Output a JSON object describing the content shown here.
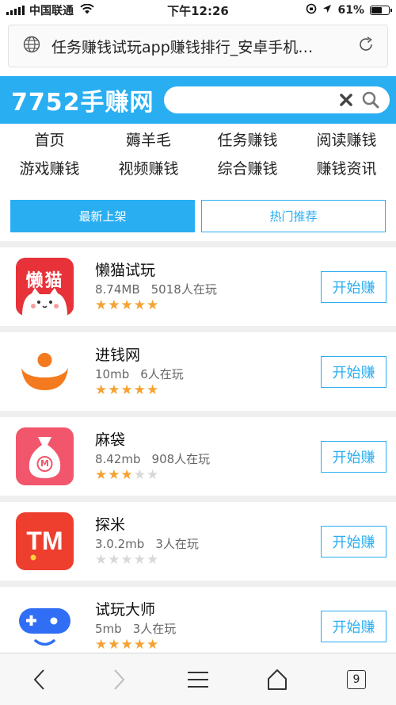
{
  "status_bar": {
    "carrier": "中国联通",
    "time": "下午12:26",
    "battery_text": "61%",
    "battery_level": 0.61
  },
  "address_bar": {
    "page_title": "任务赚钱试玩app赚钱排行_安卓手机…"
  },
  "header": {
    "logo": "7752手赚网",
    "search": {
      "value": "",
      "placeholder": ""
    }
  },
  "nav": {
    "items": [
      {
        "label": "首页"
      },
      {
        "label": "薅羊毛"
      },
      {
        "label": "任务赚钱"
      },
      {
        "label": "阅读赚钱"
      },
      {
        "label": "游戏赚钱"
      },
      {
        "label": "视频赚钱"
      },
      {
        "label": "综合赚钱"
      },
      {
        "label": "赚钱资讯"
      }
    ]
  },
  "tabs": [
    {
      "label": "最新上架",
      "active": true
    },
    {
      "label": "热门推荐",
      "active": false
    }
  ],
  "apps": [
    {
      "name": "懒猫试玩",
      "size": "8.74MB",
      "players": "5018人在玩",
      "rating": 5,
      "button": "开始赚",
      "icon": "lazy-cat-icon",
      "icon_text": "懒猫"
    },
    {
      "name": "进钱网",
      "size": "10mb",
      "players": "6人在玩",
      "rating": 5,
      "button": "开始赚",
      "icon": "money-bowl-icon"
    },
    {
      "name": "麻袋",
      "size": "8.42mb",
      "players": "908人在玩",
      "rating": 3,
      "button": "开始赚",
      "icon": "money-bag-icon",
      "icon_text": "M"
    },
    {
      "name": "探米",
      "size": "3.0.2mb",
      "players": "3人在玩",
      "rating": 0,
      "button": "开始赚",
      "icon": "tanmi-tm-icon",
      "icon_text": "TM"
    },
    {
      "name": "试玩大师",
      "size": "5mb",
      "players": "3人在玩",
      "rating": 5,
      "button": "开始赚",
      "icon": "gamepad-robot-icon"
    }
  ],
  "toolbar": {
    "tab_count": "9"
  },
  "colors": {
    "accent": "#2aaef2",
    "star_on": "#f5a233",
    "star_off": "#d8d8d8"
  }
}
